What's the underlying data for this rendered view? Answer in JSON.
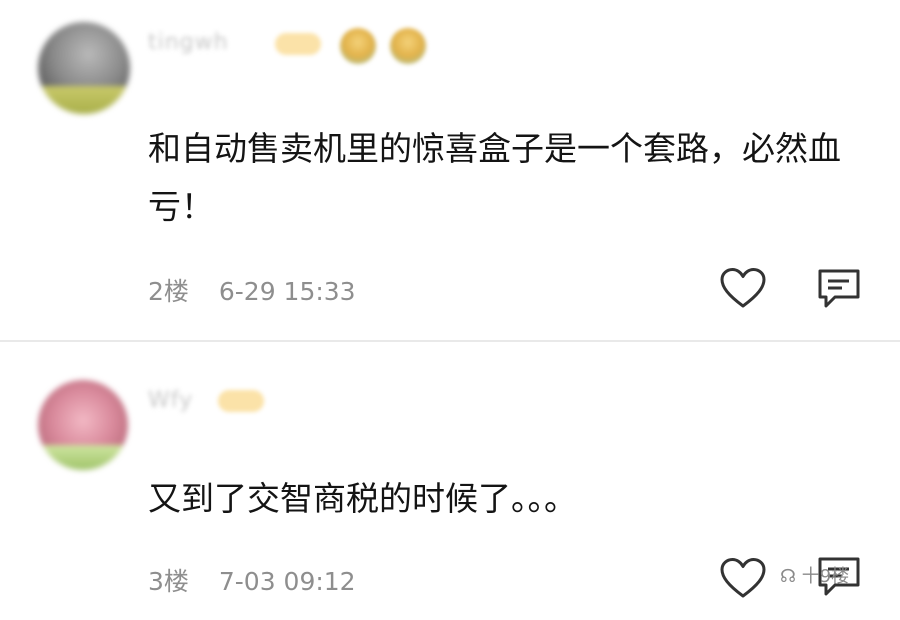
{
  "comments": [
    {
      "username": "tingwh",
      "text": "和自动售卖机里的惊喜盒子是一个套路，必然血亏！",
      "floor": "2楼",
      "time": "6-29 15:33"
    },
    {
      "username": "Wfy",
      "text": "又到了交智商税的时候了。。。",
      "floor": "3楼",
      "time": "7-03 09:12"
    }
  ],
  "icons": {
    "like": "heart-outline-icon",
    "reply": "comment-bubble-icon"
  },
  "watermark": {
    "text": "十9楼"
  },
  "colors": {
    "text": "#141414",
    "meta": "#8e8e8e",
    "icon": "#333333",
    "divider": "#e9e9e9"
  }
}
